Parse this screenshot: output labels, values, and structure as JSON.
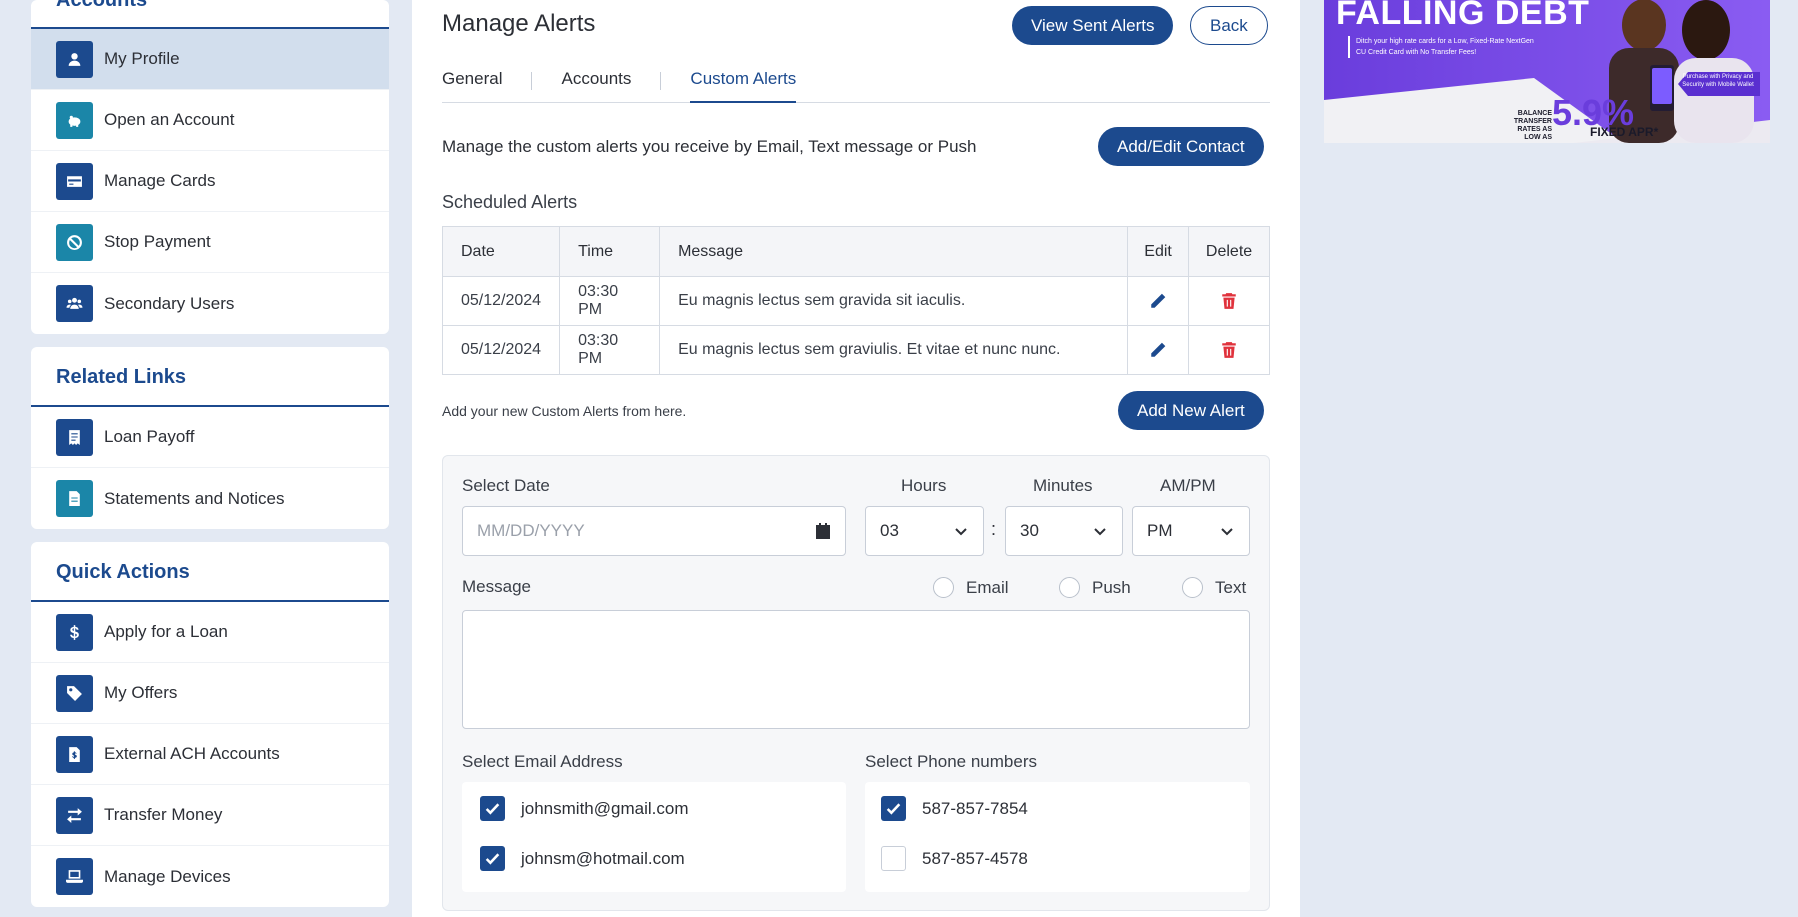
{
  "sidebar": {
    "accounts": {
      "title": "Accounts",
      "items": [
        {
          "label": "My Profile"
        },
        {
          "label": "Open an Account"
        },
        {
          "label": "Manage Cards"
        },
        {
          "label": "Stop Payment"
        },
        {
          "label": "Secondary Users"
        }
      ]
    },
    "related": {
      "title": "Related Links",
      "items": [
        {
          "label": "Loan Payoff"
        },
        {
          "label": "Statements and Notices"
        }
      ]
    },
    "quick": {
      "title": "Quick Actions",
      "items": [
        {
          "label": "Apply for a Loan"
        },
        {
          "label": "My Offers"
        },
        {
          "label": "External ACH Accounts"
        },
        {
          "label": "Transfer Money"
        },
        {
          "label": "Manage Devices"
        }
      ]
    }
  },
  "main": {
    "title": "Manage Alerts",
    "view_sent_label": "View Sent Alerts",
    "back_label": "Back",
    "tabs": [
      {
        "label": "General"
      },
      {
        "label": "Accounts"
      },
      {
        "label": "Custom Alerts"
      }
    ],
    "description": "Manage the custom alerts you receive by Email, Text message or Push",
    "add_edit_contact_label": "Add/Edit Contact",
    "scheduled_title": "Scheduled Alerts",
    "table": {
      "headers": {
        "date": "Date",
        "time": "Time",
        "message": "Message",
        "edit": "Edit",
        "delete": "Delete"
      },
      "rows": [
        {
          "date": "05/12/2024",
          "time": "03:30 PM",
          "message": "Eu magnis lectus sem gravida sit iaculis."
        },
        {
          "date": "05/12/2024",
          "time": "03:30 PM",
          "message": "Eu magnis lectus sem graviulis. Et vitae et nunc nunc."
        }
      ]
    },
    "add_hint": "Add your new Custom Alerts from here.",
    "add_new_label": "Add New Alert",
    "form": {
      "date_label": "Select Date",
      "date_placeholder": "MM/DD/YYYY",
      "hours_label": "Hours",
      "hours_value": "03",
      "minutes_label": "Minutes",
      "minutes_value": "30",
      "ampm_label": "AM/PM",
      "ampm_value": "PM",
      "colon": ":",
      "message_label": "Message",
      "channels": [
        {
          "label": "Email"
        },
        {
          "label": "Push"
        },
        {
          "label": "Text"
        }
      ],
      "email_label": "Select Email Address",
      "emails": [
        {
          "value": "johnsmith@gmail.com",
          "checked": true
        },
        {
          "value": "johnsm@hotmail.com",
          "checked": true
        }
      ],
      "phone_label": "Select Phone numbers",
      "phones": [
        {
          "value": "587-857-7854",
          "checked": true
        },
        {
          "value": "587-857-4578",
          "checked": false
        }
      ]
    }
  },
  "promo": {
    "headline": "FALLING DEBT",
    "subtext": "Ditch your high rate cards for a Low, Fixed-Rate NextGen CU Credit Card with No Transfer Fees!",
    "badge": "Purchase with Privacy and Security with Mobile Wallet",
    "rate_caption": "BALANCE TRANSFER RATES AS LOW AS",
    "rate": "5.9%",
    "rate_suffix": "FIXED APR*"
  },
  "colors": {
    "brand": "#1c4a8e",
    "teal": "#1b86a8",
    "danger": "#e0323c",
    "promo_purple": "#6b3fe0"
  }
}
